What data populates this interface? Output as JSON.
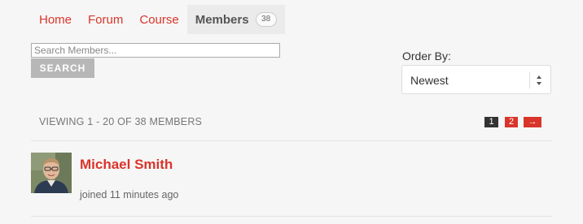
{
  "tabs": [
    {
      "label": "Home"
    },
    {
      "label": "Forum"
    },
    {
      "label": "Course"
    },
    {
      "label": "Members",
      "count": "38",
      "active": true
    }
  ],
  "search": {
    "placeholder": "Search Members...",
    "value": "",
    "button_label": "SEARCH"
  },
  "order_by": {
    "label": "Order By:",
    "selected": "Newest",
    "icon": "sort-arrows-icon"
  },
  "viewing_text": "VIEWING 1 - 20 OF 38 MEMBERS",
  "pagination": {
    "pages": [
      "1",
      "2"
    ],
    "current": "1",
    "next_label": "→"
  },
  "members": [
    {
      "name": "Michael Smith",
      "joined": "joined 11 minutes ago",
      "avatar_icon": "member-photo"
    }
  ],
  "colors": {
    "accent": "#d9352b",
    "background": "#f6f6f6",
    "active_tab_bg": "#ebebeb",
    "search_button_bg": "#b7b7b7",
    "current_page_bg": "#333333"
  }
}
